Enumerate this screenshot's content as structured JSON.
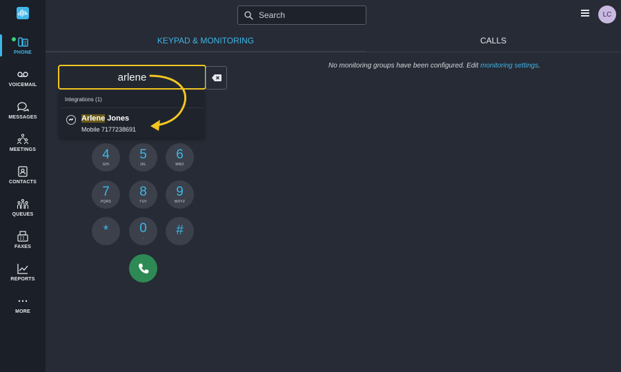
{
  "sidebar": {
    "items": [
      {
        "label": "PHONE",
        "icon": "phone-icon",
        "active": true
      },
      {
        "label": "VOICEMAIL",
        "icon": "voicemail-icon"
      },
      {
        "label": "MESSAGES",
        "icon": "messages-icon"
      },
      {
        "label": "MEETINGS",
        "icon": "meetings-icon"
      },
      {
        "label": "CONTACTS",
        "icon": "contacts-icon"
      },
      {
        "label": "QUEUES",
        "icon": "queues-icon"
      },
      {
        "label": "FAXES",
        "icon": "fax-icon"
      },
      {
        "label": "REPORTS",
        "icon": "reports-icon"
      },
      {
        "label": "MORE",
        "icon": "more-icon"
      }
    ]
  },
  "header": {
    "search_placeholder": "Search",
    "avatar_initials": "LC"
  },
  "tabs": [
    {
      "label": "KEYPAD & MONITORING",
      "active": true
    },
    {
      "label": "CALLS"
    }
  ],
  "monitoring": {
    "message": "No monitoring groups have been configured. Edit ",
    "link": "monitoring settings",
    "suffix": "."
  },
  "dialer": {
    "value": "arlene",
    "results_header": "Integrations (1)",
    "result": {
      "name_highlight": "Arlene",
      "name_rest": " Jones",
      "detail": "Mobile  7177238691"
    },
    "keys": [
      {
        "num": "4",
        "letters": "GHI"
      },
      {
        "num": "5",
        "letters": "JKL"
      },
      {
        "num": "6",
        "letters": "MNO"
      },
      {
        "num": "7",
        "letters": "PQRS"
      },
      {
        "num": "8",
        "letters": "TUV"
      },
      {
        "num": "9",
        "letters": "WXYZ"
      },
      {
        "num": "*",
        "letters": ""
      },
      {
        "num": "0",
        "letters": "·"
      },
      {
        "num": "#",
        "letters": ""
      }
    ]
  },
  "colors": {
    "accent": "#3fb6e8",
    "highlight_border": "#f3c622",
    "call_green": "#2e8a54",
    "background": "#262b35",
    "sidebar": "#1b1f27"
  }
}
